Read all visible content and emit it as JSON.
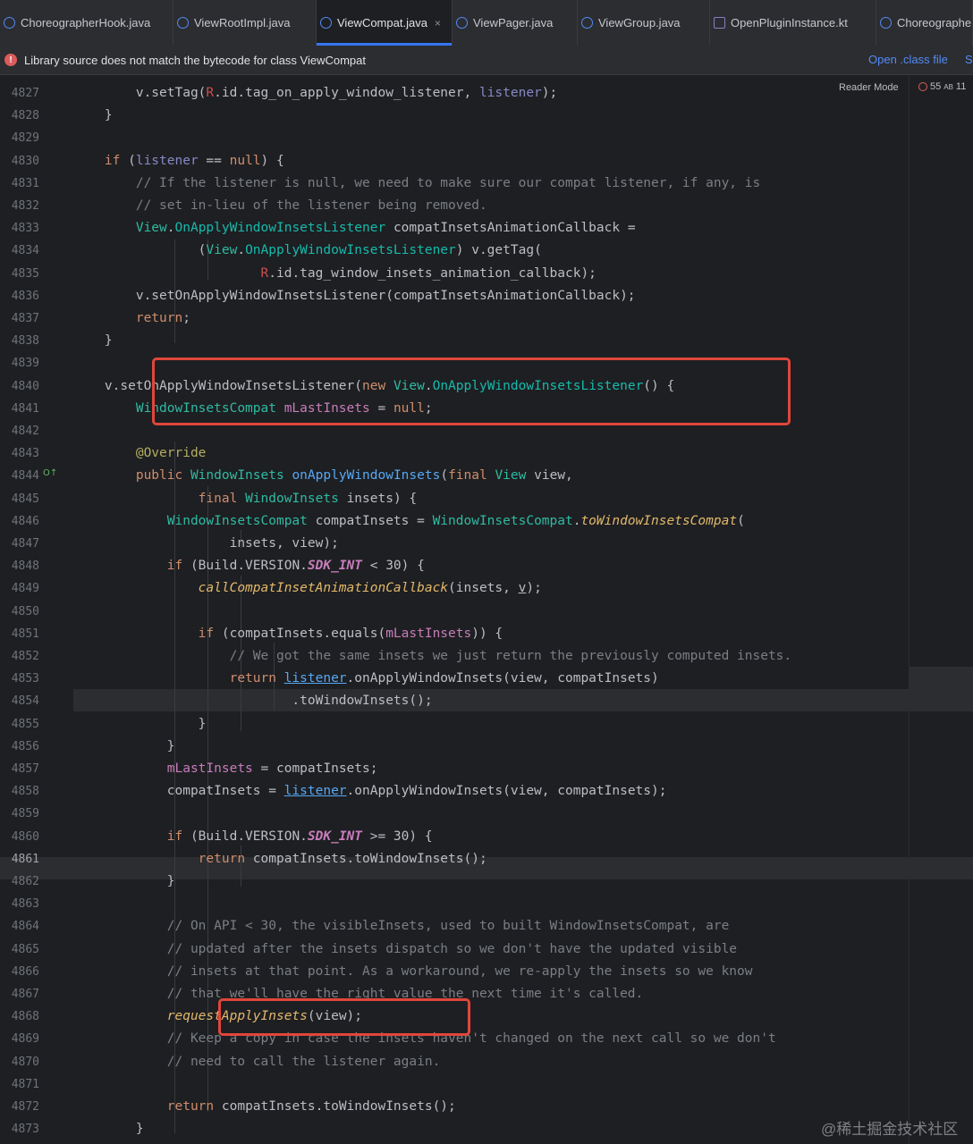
{
  "tabs": [
    {
      "label": "ChoreographerHook.java",
      "kind": "java",
      "active": false
    },
    {
      "label": "ViewRootImpl.java",
      "kind": "java",
      "active": false
    },
    {
      "label": "ViewCompat.java",
      "kind": "java",
      "active": true
    },
    {
      "label": "ViewPager.java",
      "kind": "java",
      "active": false
    },
    {
      "label": "ViewGroup.java",
      "kind": "java",
      "active": false
    },
    {
      "label": "OpenPluginInstance.kt",
      "kind": "kotlin",
      "active": false
    },
    {
      "label": "Choreographe",
      "kind": "java",
      "active": false
    }
  ],
  "tab_close_icon": "×",
  "warning": {
    "icon": "!",
    "message": "Library source does not match the bytecode for class ViewCompat",
    "open_class_label": "Open .class file",
    "extra_label": "S"
  },
  "editor_meta": {
    "reader_mode_label": "Reader Mode",
    "warning_count": "55",
    "typo_count": "11",
    "typo_icon": "AB"
  },
  "watermark": "@稀土掘金技术社区",
  "code_lines": [
    {
      "n": "4827",
      "tokens": [
        [
          "p",
          "        v.setTag("
        ],
        [
          "r",
          "R"
        ],
        [
          "p",
          ".id.tag_on_apply_window_listener, "
        ],
        [
          "lv",
          "listener"
        ],
        [
          "p",
          ");"
        ]
      ]
    },
    {
      "n": "4828",
      "tokens": [
        [
          "p",
          "    }"
        ]
      ]
    },
    {
      "n": "4829",
      "tokens": []
    },
    {
      "n": "4830",
      "tokens": [
        [
          "k",
          "    if "
        ],
        [
          "p",
          "("
        ],
        [
          "lv",
          "listener"
        ],
        [
          "p",
          " == "
        ],
        [
          "k",
          "null"
        ],
        [
          "p",
          ") {"
        ]
      ]
    },
    {
      "n": "4831",
      "tokens": [
        [
          "c",
          "        // If the listener is null, we need to make sure our compat listener, if any, is"
        ]
      ]
    },
    {
      "n": "4832",
      "tokens": [
        [
          "c",
          "        // set in-lieu of the listener being removed."
        ]
      ]
    },
    {
      "n": "4833",
      "tokens": [
        [
          "t",
          "        View"
        ],
        [
          "p",
          "."
        ],
        [
          "t2",
          "OnApplyWindowInsetsListener "
        ],
        [
          "p",
          "compatInsetsAnimationCallback ="
        ]
      ]
    },
    {
      "n": "4834",
      "tokens": [
        [
          "p",
          "                ("
        ],
        [
          "t",
          "View"
        ],
        [
          "p",
          "."
        ],
        [
          "t2",
          "OnApplyWindowInsetsListener"
        ],
        [
          "p",
          ") v.getTag("
        ]
      ]
    },
    {
      "n": "4835",
      "tokens": [
        [
          "r",
          "                        R"
        ],
        [
          "p",
          ".id.tag_window_insets_animation_callback);"
        ]
      ]
    },
    {
      "n": "4836",
      "tokens": [
        [
          "p",
          "        v.setOnApplyWindowInsetsListener(compatInsetsAnimationCallback);"
        ]
      ]
    },
    {
      "n": "4837",
      "tokens": [
        [
          "k",
          "        return"
        ],
        [
          "p",
          ";"
        ]
      ]
    },
    {
      "n": "4838",
      "tokens": [
        [
          "p",
          "    }"
        ]
      ]
    },
    {
      "n": "4839",
      "tokens": []
    },
    {
      "n": "4840",
      "tokens": [
        [
          "p",
          "    v.setOnApplyWindowInsetsListener("
        ],
        [
          "k",
          "new "
        ],
        [
          "t",
          "View"
        ],
        [
          "p",
          "."
        ],
        [
          "t2",
          "OnApplyWindowInsetsListener"
        ],
        [
          "p",
          "() {"
        ]
      ]
    },
    {
      "n": "4841",
      "tokens": [
        [
          "t",
          "        WindowInsetsCompat "
        ],
        [
          "fl",
          "mLastInsets"
        ],
        [
          "p",
          " = "
        ],
        [
          "k",
          "null"
        ],
        [
          "p",
          ";"
        ]
      ]
    },
    {
      "n": "4842",
      "tokens": []
    },
    {
      "n": "4843",
      "tokens": [
        [
          "an",
          "        @Override"
        ]
      ]
    },
    {
      "n": "4844",
      "tokens": [
        [
          "k",
          "        public "
        ],
        [
          "t",
          "WindowInsets "
        ],
        [
          "f",
          "onApplyWindowInsets"
        ],
        [
          "p",
          "("
        ],
        [
          "k",
          "final "
        ],
        [
          "t",
          "View "
        ],
        [
          "p",
          "view,"
        ]
      ]
    },
    {
      "n": "4845",
      "tokens": [
        [
          "k",
          "                final "
        ],
        [
          "t",
          "WindowInsets "
        ],
        [
          "p",
          "insets) {"
        ]
      ]
    },
    {
      "n": "4846",
      "tokens": [
        [
          "t",
          "            WindowInsetsCompat "
        ],
        [
          "p",
          "compatInsets = "
        ],
        [
          "t",
          "WindowInsetsCompat"
        ],
        [
          "p",
          "."
        ],
        [
          "callit",
          "toWindowInsetsCompat"
        ],
        [
          "p",
          "("
        ]
      ]
    },
    {
      "n": "4847",
      "tokens": [
        [
          "p",
          "                    insets, view);"
        ]
      ]
    },
    {
      "n": "4848",
      "tokens": [
        [
          "k",
          "            if "
        ],
        [
          "p",
          "(Build.VERSION."
        ],
        [
          "st",
          "SDK_INT"
        ],
        [
          "p",
          " < 30) {"
        ]
      ]
    },
    {
      "n": "4849",
      "tokens": [
        [
          "callit",
          "                callCompatInsetAnimationCallback"
        ],
        [
          "p",
          "(insets, "
        ],
        [
          "ulv",
          "v"
        ],
        [
          "p",
          ");"
        ]
      ]
    },
    {
      "n": "4850",
      "tokens": []
    },
    {
      "n": "4851",
      "tokens": [
        [
          "k",
          "                if "
        ],
        [
          "p",
          "(compatInsets.equals("
        ],
        [
          "fl",
          "mLastInsets"
        ],
        [
          "p",
          ")) {"
        ]
      ]
    },
    {
      "n": "4852",
      "tokens": [
        [
          "c",
          "                    // We got the same insets we just return the previously computed insets."
        ]
      ]
    },
    {
      "n": "4853",
      "tokens": [
        [
          "k",
          "                    return "
        ],
        [
          "ul",
          "listener"
        ],
        [
          "p",
          ".onApplyWindowInsets(view, compatInsets)"
        ]
      ]
    },
    {
      "n": "4854",
      "tokens": [
        [
          "p",
          "                            .toWindowInsets();"
        ]
      ]
    },
    {
      "n": "4855",
      "tokens": [
        [
          "p",
          "                }"
        ]
      ]
    },
    {
      "n": "4856",
      "tokens": [
        [
          "p",
          "            }"
        ]
      ]
    },
    {
      "n": "4857",
      "tokens": [
        [
          "fl",
          "            mLastInsets"
        ],
        [
          "p",
          " = compatInsets;"
        ]
      ]
    },
    {
      "n": "4858",
      "tokens": [
        [
          "p",
          "            compatInsets = "
        ],
        [
          "ul",
          "listener"
        ],
        [
          "p",
          ".onApplyWindowInsets(view, compatInsets);"
        ]
      ]
    },
    {
      "n": "4859",
      "tokens": []
    },
    {
      "n": "4860",
      "tokens": [
        [
          "k",
          "            if "
        ],
        [
          "p",
          "(Build.VERSION."
        ],
        [
          "st",
          "SDK_INT"
        ],
        [
          "p",
          " >= 30) {"
        ]
      ]
    },
    {
      "n": "4861",
      "tokens": [
        [
          "k",
          "                return "
        ],
        [
          "p",
          "compatInsets.toWindowInsets();"
        ]
      ]
    },
    {
      "n": "4862",
      "tokens": [
        [
          "p",
          "            }"
        ]
      ]
    },
    {
      "n": "4863",
      "tokens": []
    },
    {
      "n": "4864",
      "tokens": [
        [
          "c",
          "            // On API < 30, the visibleInsets, used to built WindowInsetsCompat, are"
        ]
      ]
    },
    {
      "n": "4865",
      "tokens": [
        [
          "c",
          "            // updated after the insets dispatch so we don't have the updated visible"
        ]
      ]
    },
    {
      "n": "4866",
      "tokens": [
        [
          "c",
          "            // insets at that point. As a workaround, we re-apply the insets so we know"
        ]
      ]
    },
    {
      "n": "4867",
      "tokens": [
        [
          "c",
          "            // that we'll have the right value the next time it's called."
        ]
      ]
    },
    {
      "n": "4868",
      "tokens": [
        [
          "callit",
          "            requestApplyInsets"
        ],
        [
          "p",
          "(view);"
        ]
      ]
    },
    {
      "n": "4869",
      "tokens": [
        [
          "c",
          "            // Keep a copy in case the insets haven't changed on the next call so we don't"
        ]
      ]
    },
    {
      "n": "4870",
      "tokens": [
        [
          "c",
          "            // need to call the listener again."
        ]
      ]
    },
    {
      "n": "4871",
      "tokens": []
    },
    {
      "n": "4872",
      "tokens": [
        [
          "k",
          "            return "
        ],
        [
          "p",
          "compatInsets.toWindowInsets();"
        ]
      ]
    },
    {
      "n": "4873",
      "tokens": [
        [
          "p",
          "        }"
        ]
      ]
    }
  ]
}
